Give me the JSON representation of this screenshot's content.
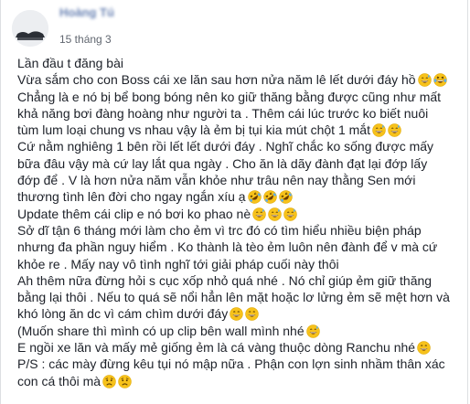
{
  "post": {
    "author_name": "Hoàng Tú",
    "timestamp": "15 tháng 3",
    "lines": [
      {
        "text": "Lần đầu t đăng bài",
        "emojis": []
      },
      {
        "text": "Vừa sắm cho con Boss cái xe lăn sau hơn nửa năm lê lết dưới đáy hồ",
        "emojis": [
          "grin-sweat",
          "laugh-tears"
        ]
      },
      {
        "text": "Chẳng là e nó bị bể bong bóng nên ko giữ thăng bằng được cũng như mất",
        "emojis": []
      },
      {
        "text": "khả năng bơi đàng hoàng như người ta . Thêm cái lúc trước ko biết nuôi",
        "emojis": []
      },
      {
        "text": "tùm lum loại chung vs nhau vậy là ẻm bị tụi kia mút chột 1 mắt",
        "emojis": [
          "grin-sweat",
          "grin-sweat"
        ]
      },
      {
        "text": "Cứ nằm nghiêng 1 bên rồi lết lết dưới đáy . Nghĩ chắc ko sống được mấy",
        "emojis": []
      },
      {
        "text": "bữa đâu vậy mà cứ lay lắt qua ngày . Cho ăn là dãy đành đạt lại đớp lấy",
        "emojis": []
      },
      {
        "text": "đớp để . V là hơn nửa năm vẫn khỏe như trâu nên nay thằng Sen mới",
        "emojis": []
      },
      {
        "text": "thương tình lên đời cho ngay ngắn xíu ạ",
        "emojis": [
          "rofl",
          "rofl",
          "rofl"
        ]
      },
      {
        "text": "Update thêm cái clip e nó bơi ko phao nè",
        "emojis": [
          "grin-sweat",
          "grin-sweat",
          "grin-sweat"
        ]
      },
      {
        "text": "Sở dĩ tận 6 tháng mới làm cho ẻm vì trc đó có tìm hiểu nhiều biện pháp",
        "emojis": []
      },
      {
        "text": "nhưng đa phần nguy hiểm . Ko thành là tèo ẻm luôn nên đành để v mà cứ",
        "emojis": []
      },
      {
        "text": "khỏe re . Mấy nay vô tình nghĩ tới giải pháp cuối này thôi",
        "emojis": []
      },
      {
        "text": "Ah thêm nữa đừng hỏi s cục xốp nhỏ quá nhé . Nó chỉ giúp ẻm giữ thăng",
        "emojis": []
      },
      {
        "text": "bằng lại thôi . Nếu to quá sẽ nổi hẳn lên mặt hoặc lơ lửng ẻm sẽ mệt hơn và",
        "emojis": []
      },
      {
        "text": "khó lòng ăn dc vì cám chìm dưới đáy",
        "emojis": [
          "grin",
          "grin"
        ]
      },
      {
        "text": "(Muốn share thì mình có up clip bên wall mình nhé",
        "emojis": [
          "grin-sweat"
        ]
      },
      {
        "text": "E ngồi xe lăn và mấy mẻ giống ẻm là cá vàng thuộc dòng Ranchu nhé",
        "emojis": [
          "grin"
        ]
      },
      {
        "text": "P/S : các mày đừng kêu tụi nó mập nữa . Phận con lợn sinh nhầm thân xác",
        "emojis": []
      },
      {
        "text": "con cá thôi mà",
        "emojis": [
          "sad",
          "sad"
        ]
      }
    ]
  },
  "colors": {
    "text": "#1d2129",
    "author": "#365899",
    "meta": "#616770",
    "emoji_face": "#f7c21b",
    "emoji_sweat": "#5dadec"
  }
}
